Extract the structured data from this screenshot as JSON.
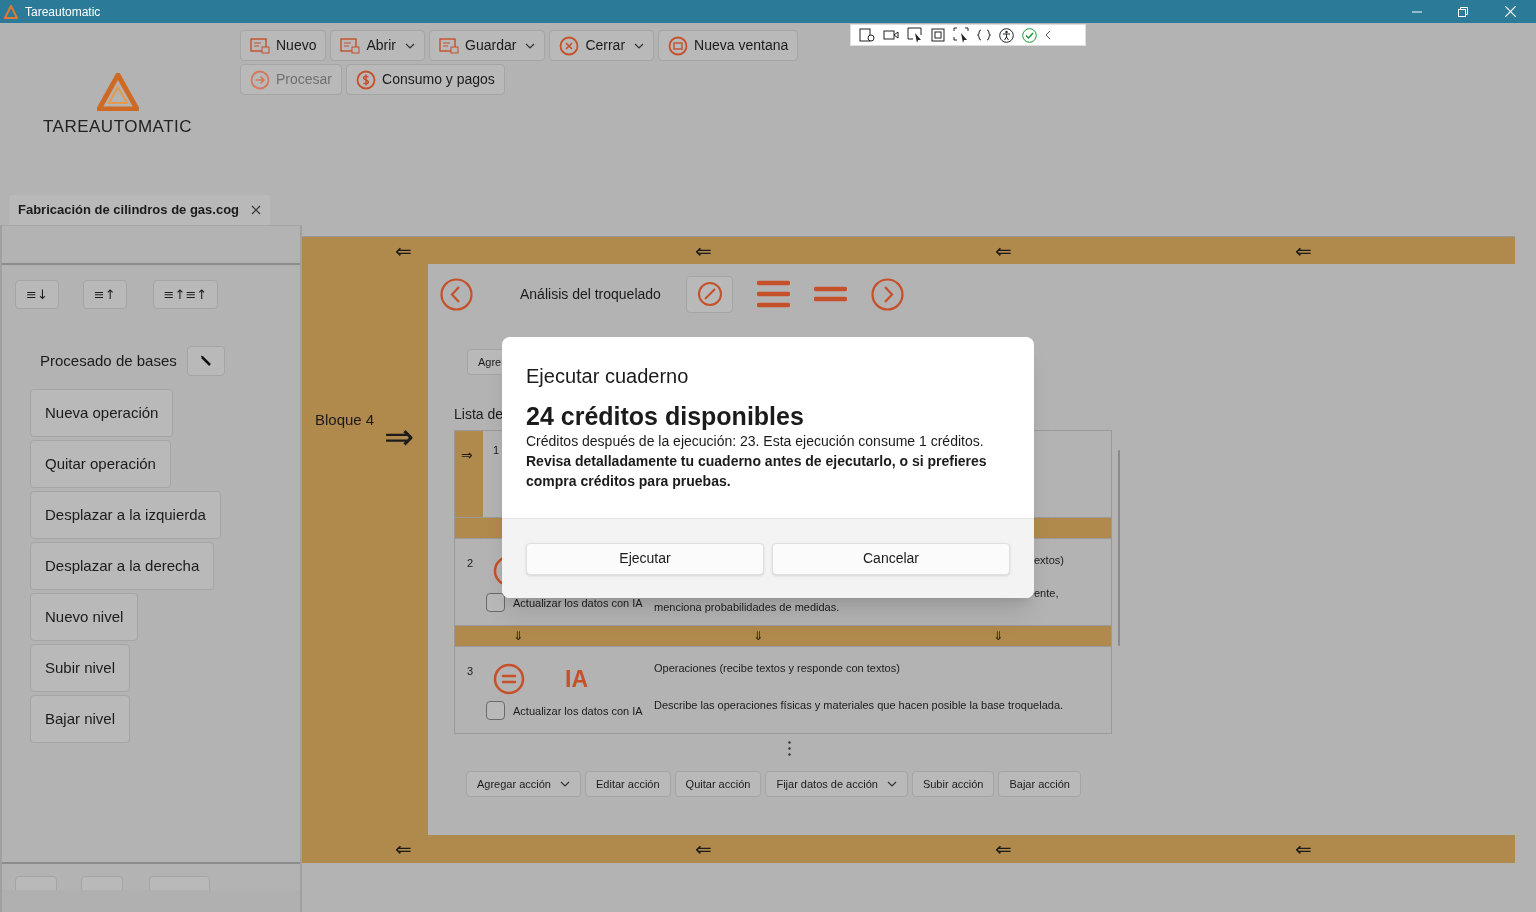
{
  "window": {
    "title": "Tareautomatic"
  },
  "logo": {
    "text": "TAREAUTOMATIC"
  },
  "toolbar": {
    "rows": [
      [
        {
          "label": "Nuevo",
          "kind": "file",
          "dropdown": false,
          "disabled": false
        },
        {
          "label": "Abrir",
          "kind": "file",
          "dropdown": true,
          "disabled": false
        },
        {
          "label": "Guardar",
          "kind": "file",
          "dropdown": true,
          "disabled": false
        },
        {
          "label": "Cerrar",
          "kind": "close",
          "dropdown": true,
          "disabled": false
        },
        {
          "label": "Nueva ventana",
          "kind": "window",
          "dropdown": false,
          "disabled": false
        }
      ],
      [
        {
          "label": "Procesar",
          "kind": "process",
          "dropdown": false,
          "disabled": true
        },
        {
          "label": "Consumo y pagos",
          "kind": "payment",
          "dropdown": false,
          "disabled": false
        }
      ]
    ]
  },
  "tabs": [
    {
      "label": "Fabricación de cilindros de gas.cog",
      "selected": true
    }
  ],
  "sidebar": {
    "sort_buttons": [
      "≡↓",
      "≡↑",
      "≡↑≡↑"
    ],
    "group_title": "Procesado de bases",
    "items": [
      "Nueva operación",
      "Quitar operación",
      "Desplazar a la izquierda",
      "Desplazar a la derecha",
      "Nuevo nivel",
      "Subir nivel",
      "Bajar nivel"
    ]
  },
  "block": {
    "label": "Bloque 4",
    "arrow": "⇒",
    "top_arrows": [
      "⇐",
      "⇐",
      "⇐",
      "⇐"
    ],
    "bottom_arrows": [
      "⇐",
      "⇐",
      "⇐",
      "⇐"
    ]
  },
  "step": {
    "title": "Análisis del troquelado"
  },
  "partial": {
    "button": "Agre",
    "list_label": "Lista de"
  },
  "actions": [
    {
      "number": "1",
      "arrow": "⇒"
    },
    {
      "number": "2",
      "separator_arrows": [
        "⇓",
        "⇓",
        "⇓"
      ],
      "checkbox": {
        "label": "Actualizar los datos con IA",
        "checked": false
      },
      "type_fragment": "extos)",
      "description_fragment": "ente,",
      "description_line": "menciona probabilidades de medidas."
    },
    {
      "number": "3",
      "badge": "IA",
      "type": "Operaciones (recibe textos y responde con textos)",
      "description": "Describe las operaciones físicas y materiales que hacen posible la base troquelada.",
      "checkbox": {
        "label": "Actualizar los datos con IA",
        "checked": false
      }
    }
  ],
  "action_buttons": [
    {
      "label": "Agregar acción",
      "dropdown": true
    },
    {
      "label": "Editar acción",
      "dropdown": false
    },
    {
      "label": "Quitar acción",
      "dropdown": false
    },
    {
      "label": "Fijar datos de acción",
      "dropdown": true
    },
    {
      "label": "Subir acción",
      "dropdown": false
    },
    {
      "label": "Bajar acción",
      "dropdown": false
    }
  ],
  "dialog": {
    "title": "Ejecutar cuaderno",
    "heading": "24 créditos disponibles",
    "message": "Créditos después de la ejecución: 23. Esta ejecución consume 1 créditos.",
    "warning": "Revisa detalladamente tu cuaderno antes de ejecutarlo, o si prefieres compra créditos para pruebas.",
    "buttons": [
      "Ejecutar",
      "Cancelar"
    ]
  }
}
